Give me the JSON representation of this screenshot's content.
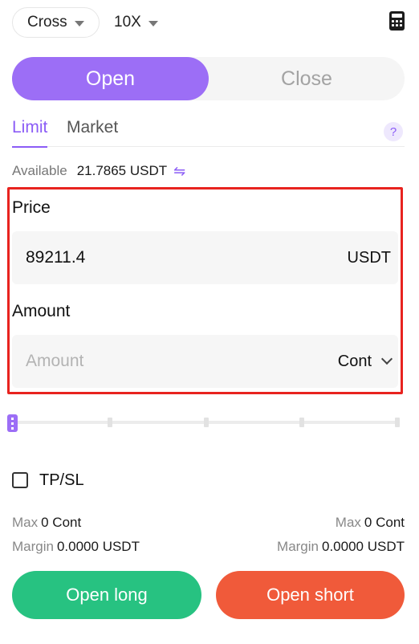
{
  "topbar": {
    "margin_mode": "Cross",
    "leverage": "10X"
  },
  "side_tabs": {
    "open": "Open",
    "close": "Close"
  },
  "order_types": {
    "limit": "Limit",
    "market": "Market",
    "help": "?"
  },
  "available": {
    "label": "Available",
    "value": "21.7865 USDT",
    "swap_glyph": "⇋"
  },
  "price": {
    "label": "Price",
    "value": "89211.4",
    "unit": "USDT"
  },
  "amount": {
    "label": "Amount",
    "placeholder": "Amount",
    "unit": "Cont"
  },
  "slider": {
    "value_percent": 0
  },
  "tpsl": {
    "label": "TP/SL",
    "checked": false
  },
  "long_stats": {
    "max_label": "Max",
    "max_value": "0 Cont",
    "margin_label": "Margin",
    "margin_value": "0.0000 USDT"
  },
  "short_stats": {
    "max_label": "Max",
    "max_value": "0 Cont",
    "margin_label": "Margin",
    "margin_value": "0.0000 USDT"
  },
  "buttons": {
    "open_long": "Open long",
    "open_short": "Open short"
  },
  "colors": {
    "accent": "#9c6ef6",
    "long": "#27c281",
    "short": "#f05a3a",
    "highlight_border": "#e8231f"
  }
}
